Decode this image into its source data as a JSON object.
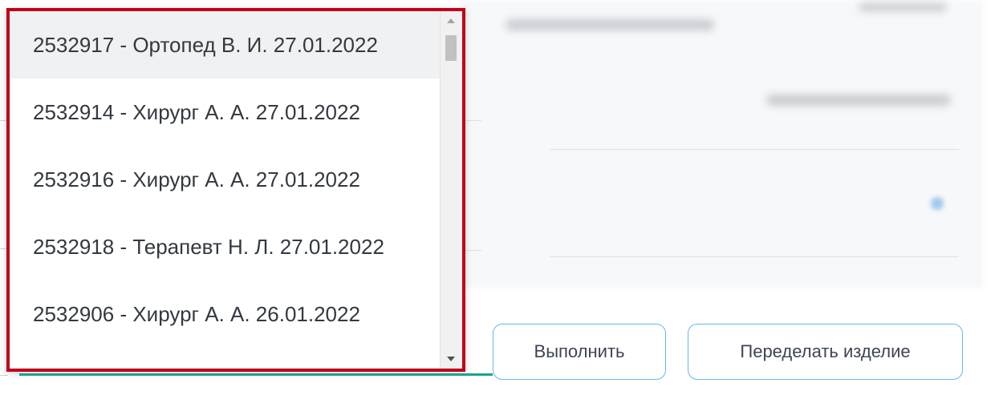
{
  "dropdown": {
    "options": [
      {
        "label": "2532917 - Ортопед В. И. 27.01.2022",
        "highlighted": true
      },
      {
        "label": "2532914 - Хирург А. А. 27.01.2022",
        "highlighted": false
      },
      {
        "label": "2532916 - Хирург А. А. 27.01.2022",
        "highlighted": false
      },
      {
        "label": "2532918 - Терапевт Н. Л. 27.01.2022",
        "highlighted": false
      },
      {
        "label": "2532906 - Хирург А. А. 26.01.2022",
        "highlighted": false
      }
    ],
    "scroll_up_icon": "arrow-up-icon",
    "scroll_down_icon": "arrow-down-icon"
  },
  "actions": {
    "execute_label": "Выполнить",
    "redo_label": "Переделать изделие"
  },
  "colors": {
    "highlight_border": "#c0001a",
    "button_border": "#65b9e6",
    "underline": "#1aa38f"
  }
}
